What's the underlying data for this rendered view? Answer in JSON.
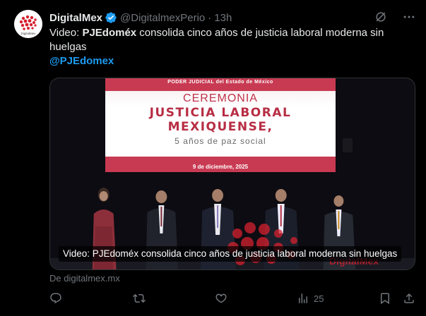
{
  "author": {
    "name": "DigitalMex",
    "handle": "@DigitalmexPerio",
    "separator": "·",
    "time": "13h",
    "avatar_text": "DigitalMex"
  },
  "post": {
    "prefix": "Video: ",
    "bold": "PJEdoméx",
    "rest": " consolida cinco años de justicia laboral moderna sin huelgas",
    "mention": "@PJEdomex"
  },
  "media": {
    "screen_header": "PODER JUDICIAL del Estado de México",
    "screen_title_1": "CEREMONIA",
    "screen_title_2": "JUSTICIA LABORAL",
    "screen_title_3": "MEXIQUENSE,",
    "screen_subtitle": "5 años de paz social",
    "screen_date": "9 de diciembre, 2025",
    "caption": "Video: PJEdoméx consolida cinco años de justicia laboral moderna sin huelgas",
    "watermark": "DigitalMex"
  },
  "source": "De digitalmex.mx",
  "actions": {
    "views": "25"
  },
  "colors": {
    "accent": "#1d9bf0",
    "muted": "#71767b",
    "text": "#e7e9ea",
    "screen_red": "#c83a52"
  }
}
